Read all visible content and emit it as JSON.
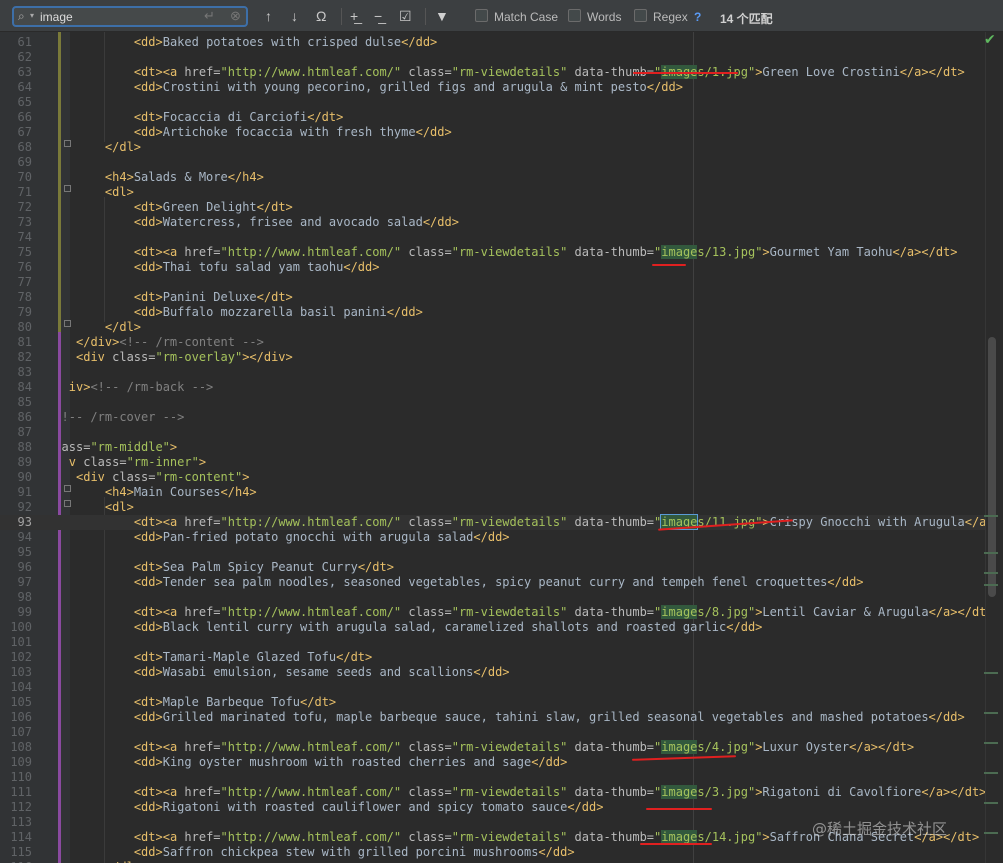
{
  "find_bar": {
    "query": "image",
    "match_case_label": "Match Case",
    "words_label": "Words",
    "regex_label": "Regex",
    "regex_help": "?",
    "match_count": "14 个匹配"
  },
  "watermark": "@稀土掘金技术社区",
  "lines": [
    {
      "n": "61",
      "seg": [
        [
          "t",
          "<dd>"
        ],
        [
          "txt",
          "Baked potatoes with crisped dulse"
        ],
        [
          "t",
          "</dd>"
        ]
      ],
      "indent": 8
    },
    {
      "n": "62",
      "seg": [],
      "indent": 0
    },
    {
      "n": "63",
      "seg": [
        [
          "t",
          "<dt><a "
        ],
        [
          "a",
          "href="
        ],
        [
          "s",
          "\"http://www.htmleaf.com/\""
        ],
        [
          "a",
          " class="
        ],
        [
          "s",
          "\"rm-viewdetails\""
        ],
        [
          "a",
          " data-thumb="
        ],
        [
          "s",
          "\""
        ],
        [
          "m",
          "image"
        ],
        [
          "s",
          "s/1.jpg\""
        ],
        [
          "t",
          ">"
        ],
        [
          "txt",
          "Green Love Crostini"
        ],
        [
          "t",
          "</a></dt>"
        ]
      ],
      "indent": 8
    },
    {
      "n": "64",
      "seg": [
        [
          "t",
          "<dd>"
        ],
        [
          "txt",
          "Crostini with young pecorino, grilled figs and arugula & mint pesto"
        ],
        [
          "t",
          "</dd>"
        ]
      ],
      "indent": 8
    },
    {
      "n": "65",
      "seg": [],
      "indent": 0
    },
    {
      "n": "66",
      "seg": [
        [
          "t",
          "<dt>"
        ],
        [
          "txt",
          "Focaccia di Carciofi"
        ],
        [
          "t",
          "</dt>"
        ]
      ],
      "indent": 8
    },
    {
      "n": "67",
      "seg": [
        [
          "t",
          "<dd>"
        ],
        [
          "txt",
          "Artichoke focaccia with fresh thyme"
        ],
        [
          "t",
          "</dd>"
        ]
      ],
      "indent": 8
    },
    {
      "n": "68",
      "seg": [
        [
          "t",
          "</dl>"
        ]
      ],
      "indent": 4
    },
    {
      "n": "69",
      "seg": [],
      "indent": 0
    },
    {
      "n": "70",
      "seg": [
        [
          "t",
          "<h4>"
        ],
        [
          "txt",
          "Salads & More"
        ],
        [
          "t",
          "</h4>"
        ]
      ],
      "indent": 4
    },
    {
      "n": "71",
      "seg": [
        [
          "t",
          "<dl>"
        ]
      ],
      "indent": 4
    },
    {
      "n": "72",
      "seg": [
        [
          "t",
          "<dt>"
        ],
        [
          "txt",
          "Green Delight"
        ],
        [
          "t",
          "</dt>"
        ]
      ],
      "indent": 8
    },
    {
      "n": "73",
      "seg": [
        [
          "t",
          "<dd>"
        ],
        [
          "txt",
          "Watercress, frisee and avocado salad"
        ],
        [
          "t",
          "</dd>"
        ]
      ],
      "indent": 8
    },
    {
      "n": "74",
      "seg": [],
      "indent": 0
    },
    {
      "n": "75",
      "seg": [
        [
          "t",
          "<dt><a "
        ],
        [
          "a",
          "href="
        ],
        [
          "s",
          "\"http://www.htmleaf.com/\""
        ],
        [
          "a",
          " class="
        ],
        [
          "s",
          "\"rm-viewdetails\""
        ],
        [
          "a",
          " data-thumb="
        ],
        [
          "s",
          "\""
        ],
        [
          "m",
          "image"
        ],
        [
          "s",
          "s/13.jpg\""
        ],
        [
          "t",
          ">"
        ],
        [
          "txt",
          "Gourmet Yam Taohu"
        ],
        [
          "t",
          "</a></dt>"
        ]
      ],
      "indent": 8
    },
    {
      "n": "76",
      "seg": [
        [
          "t",
          "<dd>"
        ],
        [
          "txt",
          "Thai tofu salad yam taohu"
        ],
        [
          "t",
          "</dd>"
        ]
      ],
      "indent": 8
    },
    {
      "n": "77",
      "seg": [],
      "indent": 0
    },
    {
      "n": "78",
      "seg": [
        [
          "t",
          "<dt>"
        ],
        [
          "txt",
          "Panini Deluxe"
        ],
        [
          "t",
          "</dt>"
        ]
      ],
      "indent": 8
    },
    {
      "n": "79",
      "seg": [
        [
          "t",
          "<dd>"
        ],
        [
          "txt",
          "Buffalo mozzarella basil panini"
        ],
        [
          "t",
          "</dd>"
        ]
      ],
      "indent": 8
    },
    {
      "n": "80",
      "seg": [
        [
          "t",
          "</dl>"
        ]
      ],
      "indent": 4
    },
    {
      "n": "81",
      "seg": [
        [
          "t",
          "</div>"
        ],
        [
          "c",
          "<!-- /rm-content -->"
        ]
      ],
      "indent": 0
    },
    {
      "n": "82",
      "seg": [
        [
          "t",
          "<div "
        ],
        [
          "a",
          "class="
        ],
        [
          "s",
          "\"rm-overlay\""
        ],
        [
          "t",
          "></div>"
        ]
      ],
      "indent": 0
    },
    {
      "n": "83",
      "seg": [],
      "indent": 0
    },
    {
      "n": "84",
      "seg": [
        [
          "t",
          "iv>"
        ],
        [
          "c",
          "<!-- /rm-back -->"
        ]
      ],
      "indent": -1
    },
    {
      "n": "85",
      "seg": [],
      "indent": 0
    },
    {
      "n": "86",
      "seg": [
        [
          "c",
          "!-- /rm-cover -->"
        ]
      ],
      "indent": -2
    },
    {
      "n": "87",
      "seg": [],
      "indent": 0
    },
    {
      "n": "88",
      "seg": [
        [
          "a",
          "ass="
        ],
        [
          "s",
          "\"rm-middle\""
        ],
        [
          "t",
          ">"
        ]
      ],
      "indent": -2
    },
    {
      "n": "89",
      "seg": [
        [
          "t",
          "v "
        ],
        [
          "a",
          "class="
        ],
        [
          "s",
          "\"rm-inner\""
        ],
        [
          "t",
          ">"
        ]
      ],
      "indent": -1
    },
    {
      "n": "90",
      "seg": [
        [
          "t",
          "<div "
        ],
        [
          "a",
          "class="
        ],
        [
          "s",
          "\"rm-content\""
        ],
        [
          "t",
          ">"
        ]
      ],
      "indent": 0
    },
    {
      "n": "91",
      "seg": [
        [
          "t",
          "<h4>"
        ],
        [
          "txt",
          "Main Courses"
        ],
        [
          "t",
          "</h4>"
        ]
      ],
      "indent": 4
    },
    {
      "n": "92",
      "seg": [
        [
          "t",
          "<dl>"
        ]
      ],
      "indent": 4
    },
    {
      "n": "93",
      "seg": [
        [
          "t",
          "<dt><a "
        ],
        [
          "a",
          "href="
        ],
        [
          "s",
          "\"http://www.htmleaf.com/\""
        ],
        [
          "a",
          " class="
        ],
        [
          "s",
          "\"rm-viewdetails\""
        ],
        [
          "a",
          " data-thumb="
        ],
        [
          "s",
          "\""
        ],
        [
          "m",
          "image"
        ],
        [
          "s",
          "s/11.jpg\""
        ],
        [
          "t",
          ">"
        ],
        [
          "txt",
          "Crispy Gnocchi with Arugula"
        ],
        [
          "t",
          "</a></dt"
        ]
      ],
      "indent": 8,
      "current": true
    },
    {
      "n": "94",
      "seg": [
        [
          "t",
          "<dd>"
        ],
        [
          "txt",
          "Pan-fried potato gnocchi with arugula salad"
        ],
        [
          "t",
          "</dd>"
        ]
      ],
      "indent": 8
    },
    {
      "n": "95",
      "seg": [],
      "indent": 0
    },
    {
      "n": "96",
      "seg": [
        [
          "t",
          "<dt>"
        ],
        [
          "txt",
          "Sea Palm Spicy Peanut Curry"
        ],
        [
          "t",
          "</dt>"
        ]
      ],
      "indent": 8
    },
    {
      "n": "97",
      "seg": [
        [
          "t",
          "<dd>"
        ],
        [
          "txt",
          "Tender sea palm noodles, seasoned vegetables, spicy peanut curry and tempeh fenel croquettes"
        ],
        [
          "t",
          "</dd>"
        ]
      ],
      "indent": 8
    },
    {
      "n": "98",
      "seg": [],
      "indent": 0
    },
    {
      "n": "99",
      "seg": [
        [
          "t",
          "<dt><a "
        ],
        [
          "a",
          "href="
        ],
        [
          "s",
          "\"http://www.htmleaf.com/\""
        ],
        [
          "a",
          " class="
        ],
        [
          "s",
          "\"rm-viewdetails\""
        ],
        [
          "a",
          " data-thumb="
        ],
        [
          "s",
          "\""
        ],
        [
          "m",
          "image"
        ],
        [
          "s",
          "s/8.jpg\""
        ],
        [
          "t",
          ">"
        ],
        [
          "txt",
          "Lentil Caviar & Arugula"
        ],
        [
          "t",
          "</a></dt>"
        ]
      ],
      "indent": 8
    },
    {
      "n": "100",
      "seg": [
        [
          "t",
          "<dd>"
        ],
        [
          "txt",
          "Black lentil curry with arugula salad, caramelized shallots and roasted garlic"
        ],
        [
          "t",
          "</dd>"
        ]
      ],
      "indent": 8
    },
    {
      "n": "101",
      "seg": [],
      "indent": 0
    },
    {
      "n": "102",
      "seg": [
        [
          "t",
          "<dt>"
        ],
        [
          "txt",
          "Tamari-Maple Glazed Tofu"
        ],
        [
          "t",
          "</dt>"
        ]
      ],
      "indent": 8
    },
    {
      "n": "103",
      "seg": [
        [
          "t",
          "<dd>"
        ],
        [
          "txt",
          "Wasabi emulsion, sesame seeds and scallions"
        ],
        [
          "t",
          "</dd>"
        ]
      ],
      "indent": 8
    },
    {
      "n": "104",
      "seg": [],
      "indent": 0
    },
    {
      "n": "105",
      "seg": [
        [
          "t",
          "<dt>"
        ],
        [
          "txt",
          "Maple Barbeque Tofu"
        ],
        [
          "t",
          "</dt>"
        ]
      ],
      "indent": 8
    },
    {
      "n": "106",
      "seg": [
        [
          "t",
          "<dd>"
        ],
        [
          "txt",
          "Grilled marinated tofu, maple barbeque sauce, tahini slaw, grilled seasonal vegetables and mashed potatoes"
        ],
        [
          "t",
          "</dd>"
        ]
      ],
      "indent": 8
    },
    {
      "n": "107",
      "seg": [],
      "indent": 0
    },
    {
      "n": "108",
      "seg": [
        [
          "t",
          "<dt><a "
        ],
        [
          "a",
          "href="
        ],
        [
          "s",
          "\"http://www.htmleaf.com/\""
        ],
        [
          "a",
          " class="
        ],
        [
          "s",
          "\"rm-viewdetails\""
        ],
        [
          "a",
          " data-thumb="
        ],
        [
          "s",
          "\""
        ],
        [
          "m",
          "image"
        ],
        [
          "s",
          "s/4.jpg\""
        ],
        [
          "t",
          ">"
        ],
        [
          "txt",
          "Luxur Oyster"
        ],
        [
          "t",
          "</a></dt>"
        ]
      ],
      "indent": 8
    },
    {
      "n": "109",
      "seg": [
        [
          "t",
          "<dd>"
        ],
        [
          "txt",
          "King oyster mushroom with roasted cherries and sage"
        ],
        [
          "t",
          "</dd>"
        ]
      ],
      "indent": 8
    },
    {
      "n": "110",
      "seg": [],
      "indent": 0
    },
    {
      "n": "111",
      "seg": [
        [
          "t",
          "<dt><a "
        ],
        [
          "a",
          "href="
        ],
        [
          "s",
          "\"http://www.htmleaf.com/\""
        ],
        [
          "a",
          " class="
        ],
        [
          "s",
          "\"rm-viewdetails\""
        ],
        [
          "a",
          " data-thumb="
        ],
        [
          "s",
          "\""
        ],
        [
          "m",
          "image"
        ],
        [
          "s",
          "s/3.jpg\""
        ],
        [
          "t",
          ">"
        ],
        [
          "txt",
          "Rigatoni di Cavolfiore"
        ],
        [
          "t",
          "</a></dt>"
        ]
      ],
      "indent": 8
    },
    {
      "n": "112",
      "seg": [
        [
          "t",
          "<dd>"
        ],
        [
          "txt",
          "Rigatoni with roasted cauliflower and spicy tomato sauce"
        ],
        [
          "t",
          "</dd>"
        ]
      ],
      "indent": 8
    },
    {
      "n": "113",
      "seg": [],
      "indent": 0
    },
    {
      "n": "114",
      "seg": [
        [
          "t",
          "<dt><a "
        ],
        [
          "a",
          "href="
        ],
        [
          "s",
          "\"http://www.htmleaf.com/\""
        ],
        [
          "a",
          " class="
        ],
        [
          "s",
          "\"rm-viewdetails\""
        ],
        [
          "a",
          " data-thumb="
        ],
        [
          "s",
          "\""
        ],
        [
          "m",
          "image"
        ],
        [
          "s",
          "s/14.jpg\""
        ],
        [
          "t",
          ">"
        ],
        [
          "txt",
          "Saffron Chana Secret"
        ],
        [
          "t",
          "</a></dt>"
        ]
      ],
      "indent": 8
    },
    {
      "n": "115",
      "seg": [
        [
          "t",
          "<dd>"
        ],
        [
          "txt",
          "Saffron chickpea stew with grilled porcini mushrooms"
        ],
        [
          "t",
          "</dd>"
        ]
      ],
      "indent": 8
    },
    {
      "n": "116",
      "seg": [
        [
          "t",
          "</dl>"
        ]
      ],
      "indent": 4
    }
  ]
}
